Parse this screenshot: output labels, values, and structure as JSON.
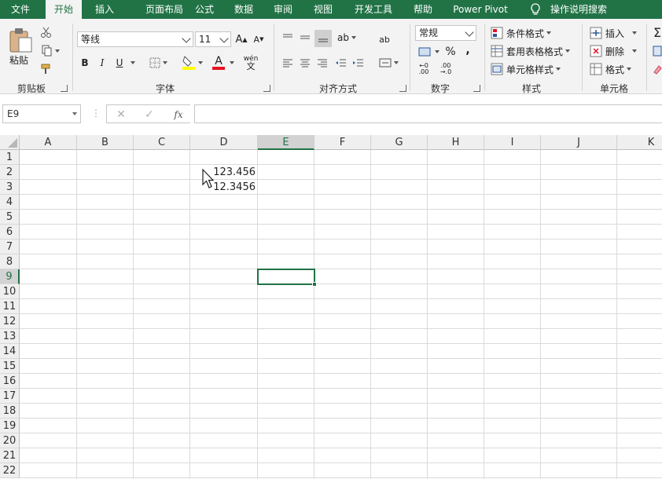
{
  "menu": {
    "tabs": [
      "文件",
      "开始",
      "插入",
      "页面布局",
      "公式",
      "数据",
      "审阅",
      "视图",
      "开发工具",
      "帮助",
      "Power Pivot"
    ],
    "search_label": "操作说明搜索",
    "active_tab": "开始"
  },
  "ribbon": {
    "clipboard": {
      "paste_label": "粘贴",
      "group_label": "剪贴板"
    },
    "font": {
      "font_name": "等线",
      "font_size": "11",
      "bold": "B",
      "italic": "I",
      "underline": "U",
      "font_color_glyph": "A",
      "phonetic_glyph": "wén",
      "group_label": "字体"
    },
    "alignment": {
      "group_label": "对齐方式"
    },
    "number": {
      "format": "常规",
      "percent": "%",
      "comma": ",",
      "group_label": "数字"
    },
    "styles": {
      "conditional": "条件格式",
      "table_format": "套用表格格式",
      "cell_styles": "单元格样式",
      "group_label": "样式"
    },
    "cells": {
      "insert": "插入",
      "delete": "删除",
      "format": "格式",
      "group_label": "单元格"
    }
  },
  "formula_bar": {
    "name_box": "E9",
    "fx": "fx",
    "content": ""
  },
  "sheet": {
    "columns": [
      "A",
      "B",
      "C",
      "D",
      "E",
      "F",
      "G",
      "H",
      "I",
      "J",
      "K"
    ],
    "rows": [
      "1",
      "2",
      "3",
      "4",
      "5",
      "6",
      "7",
      "8",
      "9",
      "10",
      "11",
      "12",
      "13",
      "14",
      "15",
      "16",
      "17",
      "18",
      "19",
      "20",
      "21",
      "22"
    ],
    "selected_cell": "E9",
    "cells": {
      "D2": "123.456",
      "D3": "12.3456"
    }
  },
  "colors": {
    "brand": "#217346",
    "ribbon_bg": "#f3f3f3",
    "font_color_bar": "#e81123",
    "highlight_bar": "#ffff00"
  }
}
